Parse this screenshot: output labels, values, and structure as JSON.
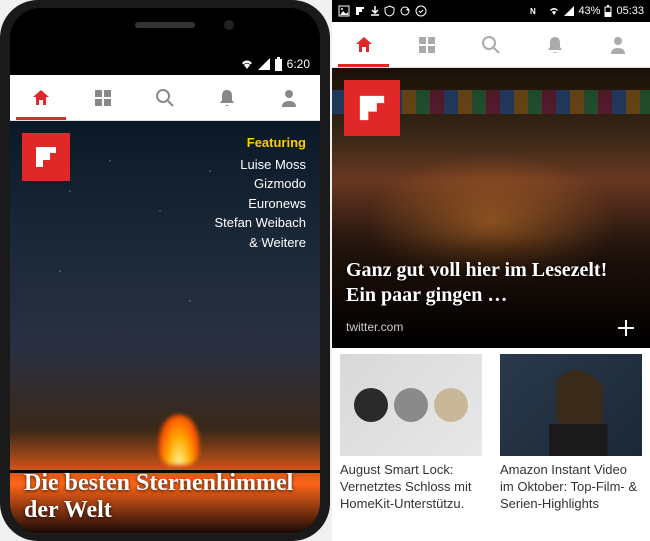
{
  "left": {
    "status": {
      "time": "6:20"
    },
    "featuring_label": "Featuring",
    "featuring_items": [
      "Luise Moss",
      "Gizmodo",
      "Euronews",
      "Stefan Weibach",
      "& Weitere"
    ],
    "hero_title": "Die besten Sternenhimmel der Welt"
  },
  "right": {
    "status": {
      "battery_pct": "43%",
      "time": "05:33"
    },
    "hero_title": "Ganz gut voll hier im Lesezelt! Ein paar gingen …",
    "hero_source": "twitter.com",
    "card1_title": "August Smart Lock: Vernetztes Schloss mit HomeKit-Unterstützu.",
    "card2_title": "Amazon Instant Video im Oktober: Top-Film- & Serien-Highlights"
  },
  "colors": {
    "accent": "#e12828"
  }
}
